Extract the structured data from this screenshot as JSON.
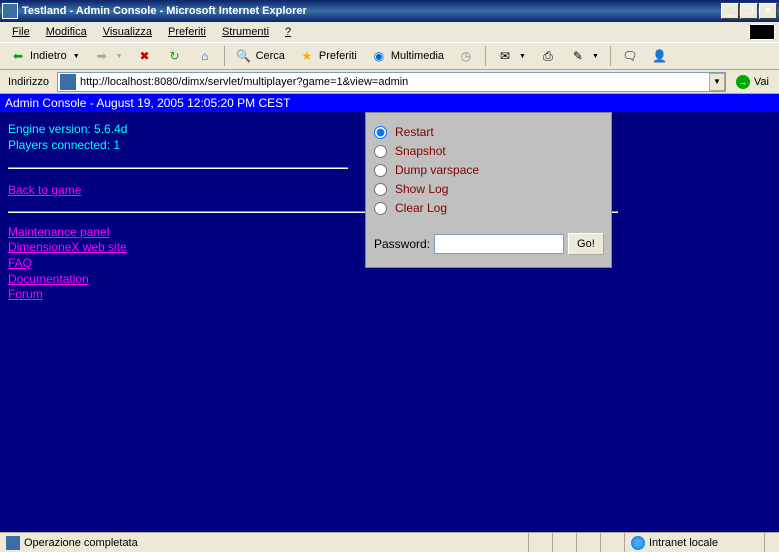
{
  "window": {
    "title": "Testland - Admin Console - Microsoft Internet Explorer"
  },
  "menu": {
    "file": "File",
    "edit": "Modifica",
    "view": "Visualizza",
    "favorites": "Preferiti",
    "tools": "Strumenti",
    "help": "?"
  },
  "toolbar": {
    "back": "Indietro",
    "search": "Cerca",
    "favorites": "Preferiti",
    "media": "Multimedia"
  },
  "address": {
    "label": "Indirizzo",
    "url": "http://localhost:8080/dimx/servlet/multiplayer?game=1&view=admin",
    "go": "Vai"
  },
  "page": {
    "banner": "Admin Console - August 19, 2005 12:05:20 PM CEST",
    "engine_version": "Engine version: 5.6.4d",
    "players_connected": "Players connected: 1",
    "back_to_game": "Back to game",
    "links": {
      "maintenance": "Maintenance panel",
      "website": "DimensioneX web site",
      "faq": "FAQ",
      "docs": "Documentation",
      "forum": "Forum"
    },
    "panel": {
      "options": {
        "restart": "Restart",
        "snapshot": "Snapshot",
        "dump": "Dump varspace",
        "showlog": "Show Log",
        "clearlog": "Clear Log"
      },
      "password_label": "Password:",
      "go_button": "Go!"
    }
  },
  "status": {
    "done": "Operazione completata",
    "zone": "Intranet locale"
  }
}
